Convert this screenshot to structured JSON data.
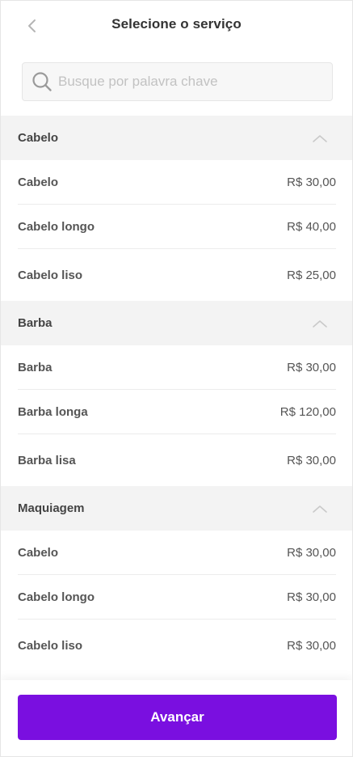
{
  "header": {
    "title": "Selecione o serviço",
    "back_icon": "chevron-left-icon"
  },
  "search": {
    "placeholder": "Busque por palavra chave",
    "value": "",
    "icon": "search-icon"
  },
  "groups": [
    {
      "title": "Cabelo",
      "expanded": true,
      "items": [
        {
          "name": "Cabelo",
          "price": "R$ 30,00"
        },
        {
          "name": "Cabelo longo",
          "price": "R$ 40,00"
        },
        {
          "name": "Cabelo liso",
          "price": "R$ 25,00"
        }
      ]
    },
    {
      "title": "Barba",
      "expanded": true,
      "items": [
        {
          "name": "Barba",
          "price": "R$ 30,00"
        },
        {
          "name": "Barba longa",
          "price": "R$ 120,00"
        },
        {
          "name": "Barba lisa",
          "price": "R$ 30,00"
        }
      ]
    },
    {
      "title": "Maquiagem",
      "expanded": true,
      "items": [
        {
          "name": "Cabelo",
          "price": "R$ 30,00"
        },
        {
          "name": "Cabelo longo",
          "price": "R$ 30,00"
        },
        {
          "name": "Cabelo liso",
          "price": "R$ 30,00"
        }
      ]
    }
  ],
  "footer": {
    "button_label": "Avançar"
  },
  "colors": {
    "accent": "#7a0fe0",
    "group_bg": "#f3f3f3"
  }
}
